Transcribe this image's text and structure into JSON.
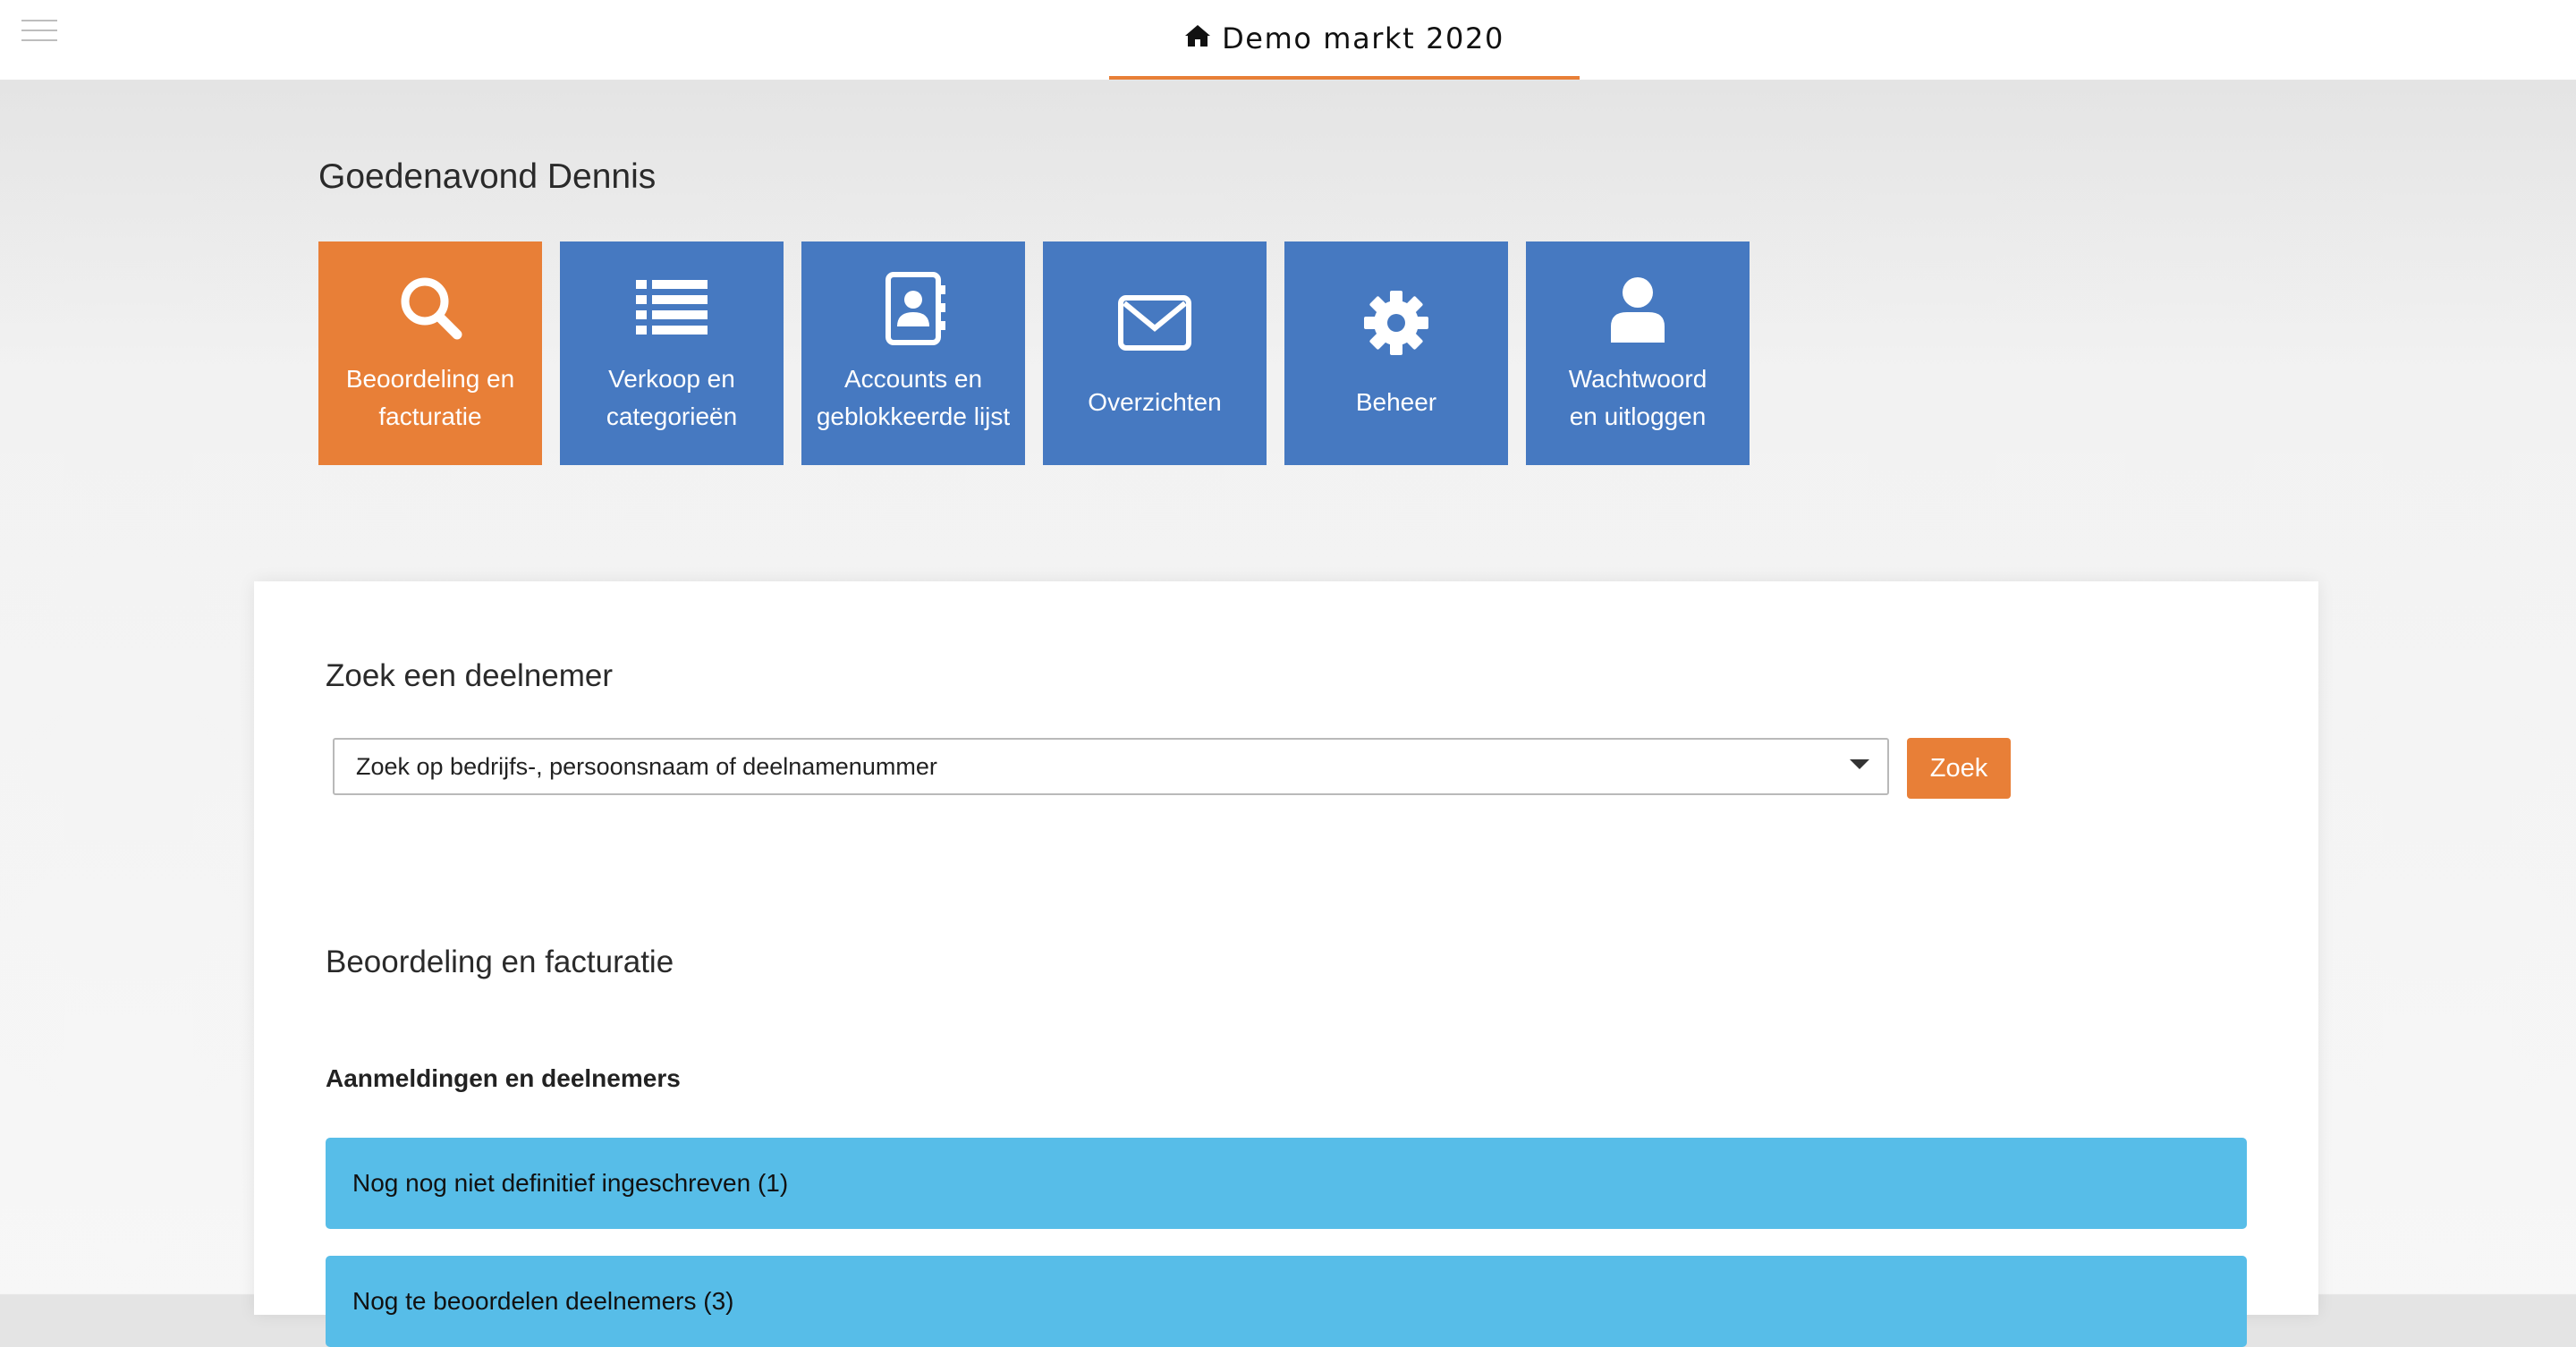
{
  "header": {
    "title": "Demo markt 2020",
    "home_icon": "home-icon",
    "menu_icon": "hamburger-icon",
    "accent_color": "#e87f37"
  },
  "greeting": "Goedenavond Dennis",
  "tiles": [
    {
      "label": "Beoordeling en\nfacturatie",
      "icon": "search-icon",
      "active": true
    },
    {
      "label": "Verkoop en\ncategorieën",
      "icon": "list-icon",
      "active": false
    },
    {
      "label": "Accounts en\ngeblokkeerde lijst",
      "icon": "address-book-icon",
      "active": false
    },
    {
      "label": "Overzichten",
      "icon": "envelope-icon",
      "active": false
    },
    {
      "label": "Beheer",
      "icon": "gear-icon",
      "active": false
    },
    {
      "label": "Wachtwoord\nen uitloggen",
      "icon": "user-icon",
      "active": false
    }
  ],
  "colors": {
    "tile_default": "#4679c1",
    "tile_active": "#e87f37",
    "status_row": "#57bde8",
    "button": "#e87f37"
  },
  "search": {
    "title": "Zoek een deelnemer",
    "placeholder": "Zoek op bedrijfs-, persoonsnaam of deelnamenummer",
    "button_label": "Zoek"
  },
  "section": {
    "title": "Beoordeling en facturatie",
    "subheading": "Aanmeldingen en deelnemers",
    "rows": [
      {
        "label": "Nog nog niet definitief ingeschreven (1)"
      },
      {
        "label": "Nog te beoordelen deelnemers (3)"
      }
    ]
  }
}
